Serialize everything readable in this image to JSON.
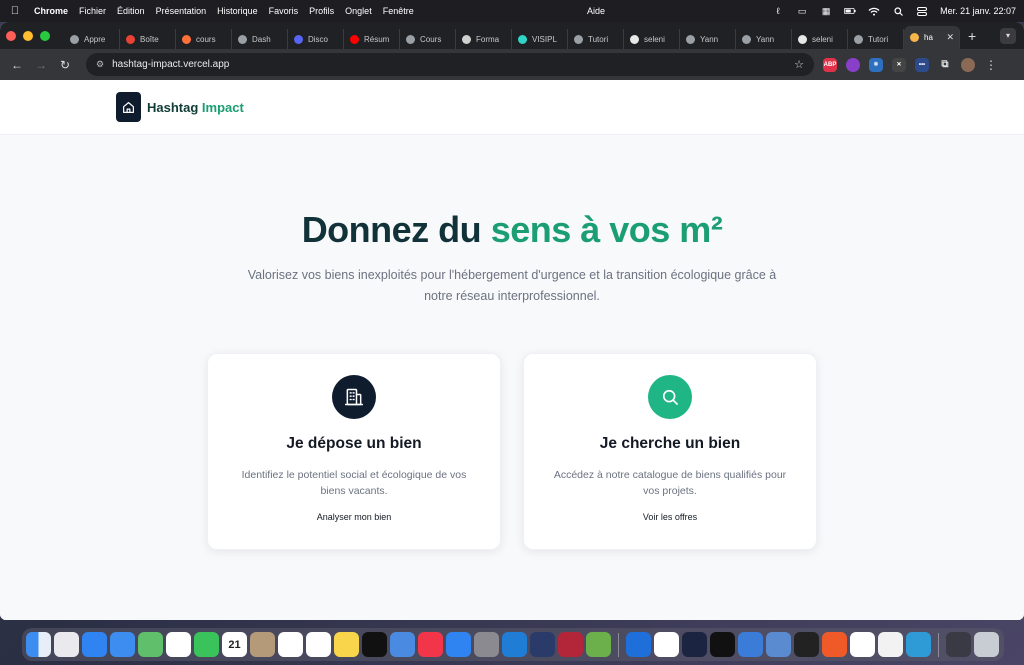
{
  "menubar": {
    "app": "Chrome",
    "items": [
      "Fichier",
      "Édition",
      "Présentation",
      "Historique",
      "Favoris",
      "Profils",
      "Onglet",
      "Fenêtre"
    ],
    "help": "Aide",
    "clock": "Mer. 21 janv.  22:07"
  },
  "browser": {
    "tabs": [
      {
        "label": "Appre",
        "icon": "globe-icon"
      },
      {
        "label": "Boîte",
        "icon": "gmail-icon"
      },
      {
        "label": "cours",
        "icon": "firefox-icon"
      },
      {
        "label": "Dash",
        "icon": "globe-icon"
      },
      {
        "label": "Disco",
        "icon": "discord-icon"
      },
      {
        "label": "Résum",
        "icon": "youtube-icon"
      },
      {
        "label": "Cours",
        "icon": "globe-icon"
      },
      {
        "label": "Forma",
        "icon": "openai-icon"
      },
      {
        "label": "VISIPL",
        "icon": "visipl-icon"
      },
      {
        "label": "Tutori",
        "icon": "globe-icon"
      },
      {
        "label": "seleni",
        "icon": "cube-icon"
      },
      {
        "label": "Yann",
        "icon": "globe-icon"
      },
      {
        "label": "Yann",
        "icon": "globe-icon"
      },
      {
        "label": "seleni",
        "icon": "cube-icon"
      },
      {
        "label": "Tutori",
        "icon": "globe-icon"
      }
    ],
    "active_tab": {
      "label": "ha"
    },
    "url": "hashtag-impact.vercel.app"
  },
  "site": {
    "logo": {
      "name": "Hashtag",
      "accent": "Impact"
    },
    "hero": {
      "title_part1": "Donnez du",
      "title_part2": "sens à vos m²",
      "subtitle": "Valorisez vos biens inexploités pour l'hébergement d'urgence et la transition écologique grâce à notre réseau interprofessionnel."
    },
    "cards": [
      {
        "title": "Je dépose un bien",
        "description": "Identifiez le potentiel social et écologique de vos biens vacants.",
        "link": "Analyser mon bien",
        "icon": "building-icon"
      },
      {
        "title": "Je cherche un bien",
        "description": "Accédez à notre catalogue de biens qualifiés pour vos projets.",
        "link": "Voir les offres",
        "icon": "search-icon"
      }
    ]
  },
  "dock": {
    "calendar_day": "21"
  },
  "colors": {
    "brand_dark": "#0f1c2e",
    "brand_green": "#1a9e72",
    "icon_green": "#1fb584"
  }
}
